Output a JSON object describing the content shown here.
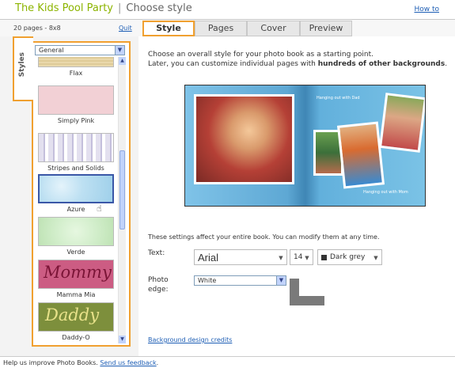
{
  "header": {
    "project": "The Kids Pool Party",
    "separator": "|",
    "step": "Choose style",
    "howto": "How to"
  },
  "tabbar": {
    "info": "20 pages - 8x8",
    "quit": "Quit",
    "tabs": [
      "Style",
      "Pages",
      "Cover",
      "Preview"
    ],
    "active_tab": "Style"
  },
  "sidebar": {
    "vertical_tab": "Styles",
    "category": "General",
    "items": [
      {
        "name": "Flax",
        "color": "#e6d4a6"
      },
      {
        "name": "Simply Pink",
        "color": "#f2d0d5"
      },
      {
        "name": "Stripes and Solids",
        "color": "#e3e0ef"
      },
      {
        "name": "Azure",
        "color": "#bde0f2",
        "selected": true
      },
      {
        "name": "Verde",
        "color": "#d2eecb"
      },
      {
        "name": "Mamma Mia",
        "color": "#cc5c83",
        "script": "Mommy"
      },
      {
        "name": "Daddy-O",
        "color": "#7d8f3c",
        "script": "Daddy"
      }
    ]
  },
  "main": {
    "intro_line1": "Choose an overall style for your photo book as a starting point.",
    "intro_line2_pre": "Later, you can customize individual pages with ",
    "intro_line2_bold": "hundreds of other backgrounds",
    "intro_line2_post": ".",
    "captions": {
      "top": "Hanging out with Dad",
      "bottom": "Hanging out with Mom"
    },
    "settings_note": "These settings affect your entire book. You can modify them at any time.",
    "text_label": "Text:",
    "font": "Arial",
    "font_size": "14",
    "font_color": "Dark grey",
    "photo_edge_label_1": "Photo",
    "photo_edge_label_2": "edge:",
    "photo_edge": "White",
    "credits": "Background design credits"
  },
  "footer": {
    "text": "Help us improve Photo Books.",
    "link": "Send us feedback",
    "end": "."
  },
  "colors": {
    "accent": "#f0a030",
    "brand_green": "#8cb400",
    "link": "#1f5fb5"
  }
}
